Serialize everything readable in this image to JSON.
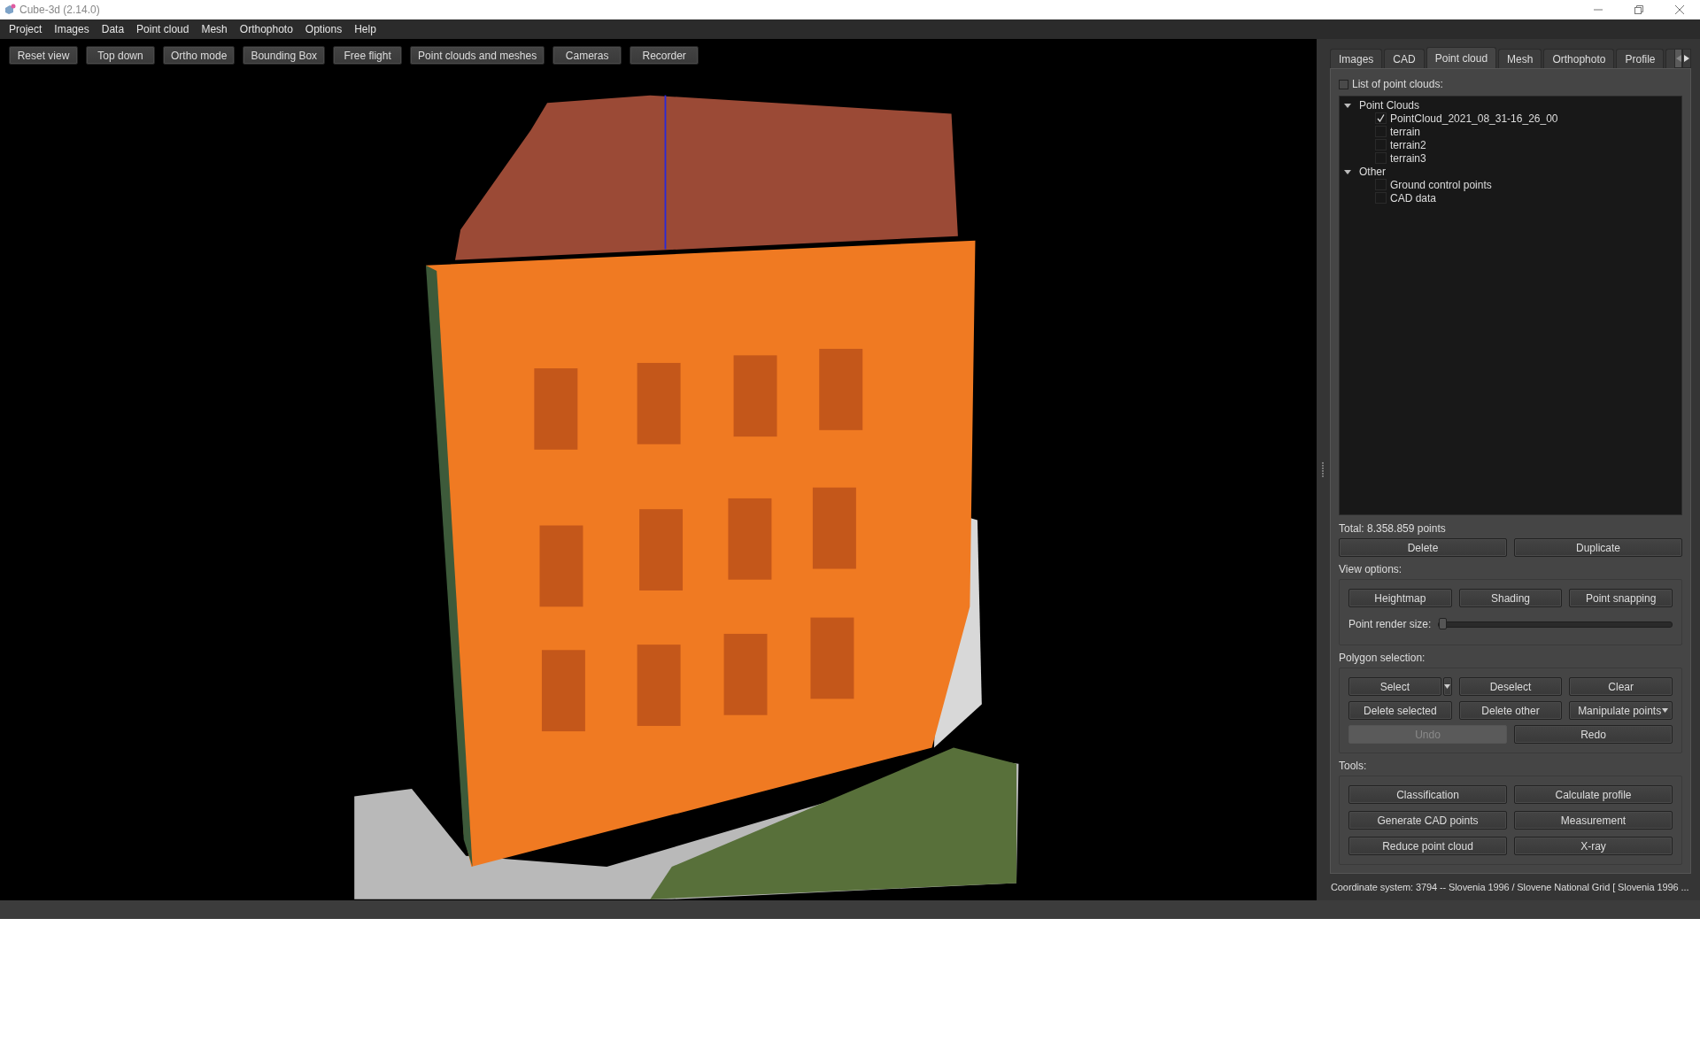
{
  "window": {
    "title": "Cube-3d (2.14.0)"
  },
  "menu": [
    "Project",
    "Images",
    "Data",
    "Point cloud",
    "Mesh",
    "Orthophoto",
    "Options",
    "Help"
  ],
  "toolbar": [
    "Reset view",
    "Top down",
    "Ortho mode",
    "Bounding Box",
    "Free flight",
    "Point clouds and meshes",
    "Cameras",
    "Recorder"
  ],
  "tabs": [
    {
      "label": "Images",
      "selected": false
    },
    {
      "label": "CAD",
      "selected": false
    },
    {
      "label": "Point cloud",
      "selected": true
    },
    {
      "label": "Mesh",
      "selected": false
    },
    {
      "label": "Orthophoto",
      "selected": false
    },
    {
      "label": "Profile",
      "selected": false
    }
  ],
  "point_cloud_list": {
    "label": "List of point clouds:",
    "checked": false
  },
  "tree": [
    {
      "label": "Point Clouds",
      "expanded": true,
      "children": [
        {
          "label": "PointCloud_2021_08_31-16_26_00",
          "checked": true
        },
        {
          "label": "terrain",
          "checked": false
        },
        {
          "label": "terrain2",
          "checked": false
        },
        {
          "label": "terrain3",
          "checked": false
        }
      ]
    },
    {
      "label": "Other",
      "expanded": true,
      "children": [
        {
          "label": "Ground control points",
          "checked": false
        },
        {
          "label": "CAD data",
          "checked": false
        }
      ]
    }
  ],
  "total": "Total: 8.358.859 points",
  "list_buttons": [
    "Delete",
    "Duplicate"
  ],
  "view_options": {
    "label": "View options:",
    "buttons": [
      "Heightmap",
      "Shading",
      "Point snapping"
    ],
    "slider": {
      "label": "Point render size:",
      "level": 0
    }
  },
  "polygon_selection": {
    "label": "Polygon selection:",
    "rows": [
      [
        {
          "label": "Select",
          "kind": "split",
          "disabled": false
        },
        {
          "label": "Deselect",
          "kind": "plain",
          "disabled": false
        },
        {
          "label": "Clear",
          "kind": "plain",
          "disabled": false
        }
      ],
      [
        {
          "label": "Delete selected",
          "kind": "plain",
          "disabled": false
        },
        {
          "label": "Delete other",
          "kind": "plain",
          "disabled": false
        },
        {
          "label": "Manipulate points",
          "kind": "dropdown",
          "disabled": false
        }
      ],
      [
        {
          "label": "Undo",
          "kind": "plain",
          "disabled": true
        },
        {
          "label": "Redo",
          "kind": "plain",
          "disabled": false
        }
      ]
    ]
  },
  "tools": {
    "label": "Tools:",
    "buttons": [
      "Classification",
      "Calculate profile",
      "Generate CAD points",
      "Measurement",
      "Reduce point cloud",
      "X-ray"
    ]
  },
  "status": "Coordinate system: 3794 -- Slovenia 1996 / Slovene National Grid [ Slovenia 1996 ..."
}
